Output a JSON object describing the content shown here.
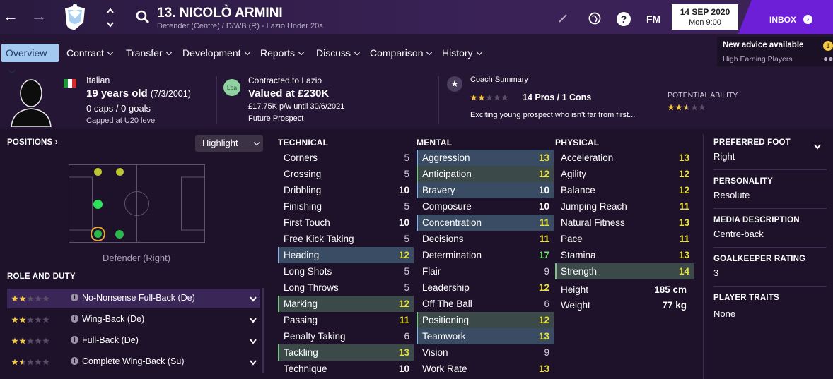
{
  "header": {
    "title": "13. NICOLÒ ARMINI",
    "subtitle": "Defender (Centre) / D/WB (R) - Lazio Under 20s",
    "fm_label": "FM",
    "date": "14 SEP 2020",
    "time": "Mon 9:00",
    "inbox_label": "INBOX",
    "advice_title": "New advice available",
    "advice_sub": "High Earning Players",
    "advice_count": "1"
  },
  "tabs": [
    {
      "label": "Overview"
    },
    {
      "label": "Contract"
    },
    {
      "label": "Transfer"
    },
    {
      "label": "Development"
    },
    {
      "label": "Reports"
    },
    {
      "label": "Discuss"
    },
    {
      "label": "Comparison"
    },
    {
      "label": "History"
    }
  ],
  "info": {
    "nationality": "Italian",
    "age": "19 years old",
    "dob": "(7/3/2001)",
    "caps": "0 caps / 0 goals",
    "capped": "Capped at U20 level",
    "contract_title": "Contracted to Lazio",
    "club_badge": "Loa",
    "value": "Valued at £230K",
    "wage": "£17.75K p/w until 30/6/2021",
    "status": "Future Prospect",
    "coach_title": "Coach Summary",
    "coach_rating": 2,
    "pros_cons": "14 Pros / 1 Cons",
    "coach_text": "Exciting young prospect who isn't far from first...",
    "potential_label": "POTENTIAL ABILITY",
    "potential_rating": 2.5
  },
  "positions": {
    "title": "POSITIONS",
    "highlight_label": "Highlight",
    "position_text": "Defender (Right)"
  },
  "roles": {
    "title": "ROLE AND DUTY",
    "items": [
      {
        "name": "No-Nonsense Full-Back (De)",
        "stars": 2,
        "selected": true
      },
      {
        "name": "Wing-Back (De)",
        "stars": 2,
        "selected": false
      },
      {
        "name": "Full-Back (De)",
        "stars": 2,
        "selected": false
      },
      {
        "name": "Complete Wing-Back (Su)",
        "stars": 1.5,
        "selected": false
      }
    ]
  },
  "technical": {
    "title": "TECHNICAL",
    "attrs": [
      {
        "name": "Corners",
        "value": "5"
      },
      {
        "name": "Crossing",
        "value": "5"
      },
      {
        "name": "Dribbling",
        "value": "10"
      },
      {
        "name": "Finishing",
        "value": "5"
      },
      {
        "name": "First Touch",
        "value": "10"
      },
      {
        "name": "Free Kick Taking",
        "value": "5"
      },
      {
        "name": "Heading",
        "value": "12"
      },
      {
        "name": "Long Shots",
        "value": "5"
      },
      {
        "name": "Long Throws",
        "value": "5"
      },
      {
        "name": "Marking",
        "value": "12"
      },
      {
        "name": "Passing",
        "value": "11"
      },
      {
        "name": "Penalty Taking",
        "value": "6"
      },
      {
        "name": "Tackling",
        "value": "13"
      },
      {
        "name": "Technique",
        "value": "10"
      }
    ]
  },
  "mental": {
    "title": "MENTAL",
    "attrs": [
      {
        "name": "Aggression",
        "value": "13"
      },
      {
        "name": "Anticipation",
        "value": "12"
      },
      {
        "name": "Bravery",
        "value": "10"
      },
      {
        "name": "Composure",
        "value": "10"
      },
      {
        "name": "Concentration",
        "value": "11"
      },
      {
        "name": "Decisions",
        "value": "11"
      },
      {
        "name": "Determination",
        "value": "17"
      },
      {
        "name": "Flair",
        "value": "9"
      },
      {
        "name": "Leadership",
        "value": "12"
      },
      {
        "name": "Off The Ball",
        "value": "6"
      },
      {
        "name": "Positioning",
        "value": "12"
      },
      {
        "name": "Teamwork",
        "value": "13"
      },
      {
        "name": "Vision",
        "value": "9"
      },
      {
        "name": "Work Rate",
        "value": "13"
      }
    ]
  },
  "physical": {
    "title": "PHYSICAL",
    "attrs": [
      {
        "name": "Acceleration",
        "value": "13"
      },
      {
        "name": "Agility",
        "value": "12"
      },
      {
        "name": "Balance",
        "value": "12"
      },
      {
        "name": "Jumping Reach",
        "value": "11"
      },
      {
        "name": "Natural Fitness",
        "value": "13"
      },
      {
        "name": "Pace",
        "value": "11"
      },
      {
        "name": "Stamina",
        "value": "13"
      },
      {
        "name": "Strength",
        "value": "14"
      }
    ],
    "height_label": "Height",
    "height": "185 cm",
    "weight_label": "Weight",
    "weight": "77 kg"
  },
  "profile": {
    "foot_label": "PREFERRED FOOT",
    "foot": "Right",
    "personality_label": "PERSONALITY",
    "personality": "Resolute",
    "media_label": "MEDIA DESCRIPTION",
    "media": "Centre-back",
    "gk_label": "GOALKEEPER RATING",
    "gk": "3",
    "traits_label": "PLAYER TRAITS",
    "traits": "None"
  },
  "colors": {
    "background": "#241634",
    "accent_purple": "#6c1fd6",
    "tab_active": "#a4c9f0",
    "value_yellow": "#e8e23a",
    "value_green": "#6ee26e",
    "star": "#f2c744"
  }
}
